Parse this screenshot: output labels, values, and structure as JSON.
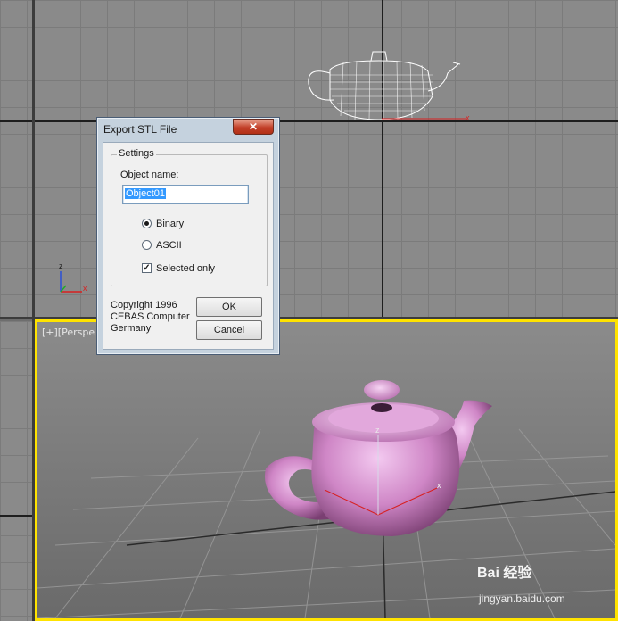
{
  "viewports": {
    "perspective_label": "[+][Perspe"
  },
  "gizmo": {
    "z": "z",
    "x": "x"
  },
  "dialog": {
    "title": "Export STL File",
    "close_glyph": "✕",
    "group_title": "Settings",
    "object_name_label": "Object name:",
    "object_name_value": "Object01",
    "radio_binary": "Binary",
    "radio_ascii": "ASCII",
    "selected_binary": true,
    "checkbox_selected_only": "Selected only",
    "selected_only_checked": true,
    "copyright": "Copyright 1996\nCEBAS Computer\nGermany",
    "ok_label": "OK",
    "cancel_label": "Cancel"
  },
  "watermark": {
    "brand": "Bai 经验",
    "url": "jingyan.baidu.com"
  }
}
